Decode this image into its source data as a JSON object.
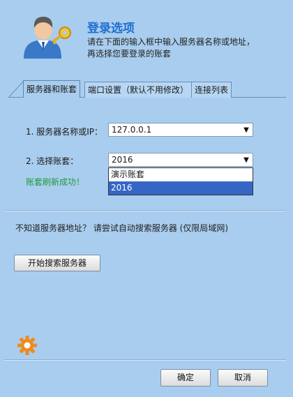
{
  "header": {
    "title": "登录选项",
    "desc_line1": "请在下面的输入框中输入服务器名称或地址，",
    "desc_line2": "再选择您要登录的账套"
  },
  "tabs": [
    {
      "label": "服务器和账套"
    },
    {
      "label": "端口设置（默认不用修改）"
    },
    {
      "label": "连接列表"
    }
  ],
  "form": {
    "server_label": "1. 服务器名称或IP：",
    "server_value": "127.0.0.1",
    "account_label": "2. 选择账套：",
    "account_value": "2016",
    "account_options": [
      "演示账套",
      "2016"
    ],
    "status": "账套刷新成功！"
  },
  "search": {
    "hint": "不知道服务器地址？ 请尝试自动搜索服务器 (仅限局域网)",
    "button": "开始搜索服务器"
  },
  "footer": {
    "ok": "确定",
    "cancel": "取消"
  },
  "colors": {
    "background": "#a9cdee",
    "title": "#1f6fcf",
    "status": "#1e9a3c",
    "selection": "#3566c6",
    "gear": "#f08a1c"
  }
}
